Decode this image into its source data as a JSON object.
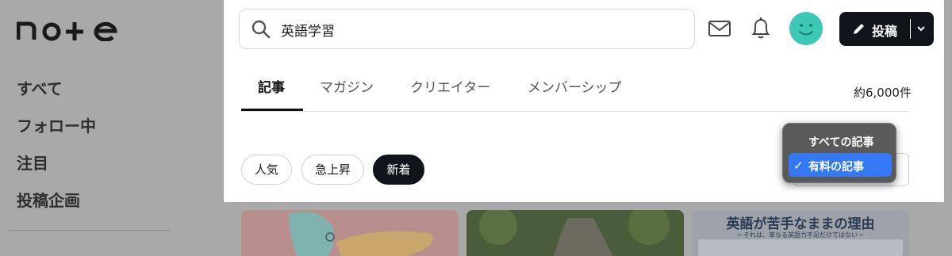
{
  "app": {
    "logo": "note"
  },
  "sidebar": {
    "items": [
      {
        "label": "すべて"
      },
      {
        "label": "フォロー中"
      },
      {
        "label": "注目"
      },
      {
        "label": "投稿企画"
      }
    ]
  },
  "header": {
    "search": {
      "value": "英語学習",
      "icon": "search-icon"
    },
    "icons": [
      "mail-icon",
      "bell-icon"
    ],
    "avatar_color": "#3cc8b4",
    "post_button": {
      "label": "投稿",
      "icon": "pencil-icon"
    }
  },
  "tabs": [
    {
      "label": "記事",
      "active": true
    },
    {
      "label": "マガジン",
      "active": false
    },
    {
      "label": "クリエイター",
      "active": false
    },
    {
      "label": "メンバーシップ",
      "active": false
    }
  ],
  "result_count": "約6,000件",
  "filters": [
    {
      "label": "人気",
      "active": false
    },
    {
      "label": "急上昇",
      "active": false
    },
    {
      "label": "新着",
      "active": true
    }
  ],
  "sort_dropdown": {
    "options": [
      {
        "label": "すべての記事",
        "selected": false
      },
      {
        "label": "有料の記事",
        "selected": true
      }
    ]
  },
  "thumbnails": [
    {
      "kind": "illustration"
    },
    {
      "kind": "photo"
    },
    {
      "title": "英語が苦手なままの理由",
      "subtitle": "─ それは、単なる英語力不足だけではない ─"
    }
  ],
  "colors": {
    "accent_dark": "#0f151a",
    "dropdown_highlight": "#3478f6",
    "overlay": "#a9a9a9"
  }
}
